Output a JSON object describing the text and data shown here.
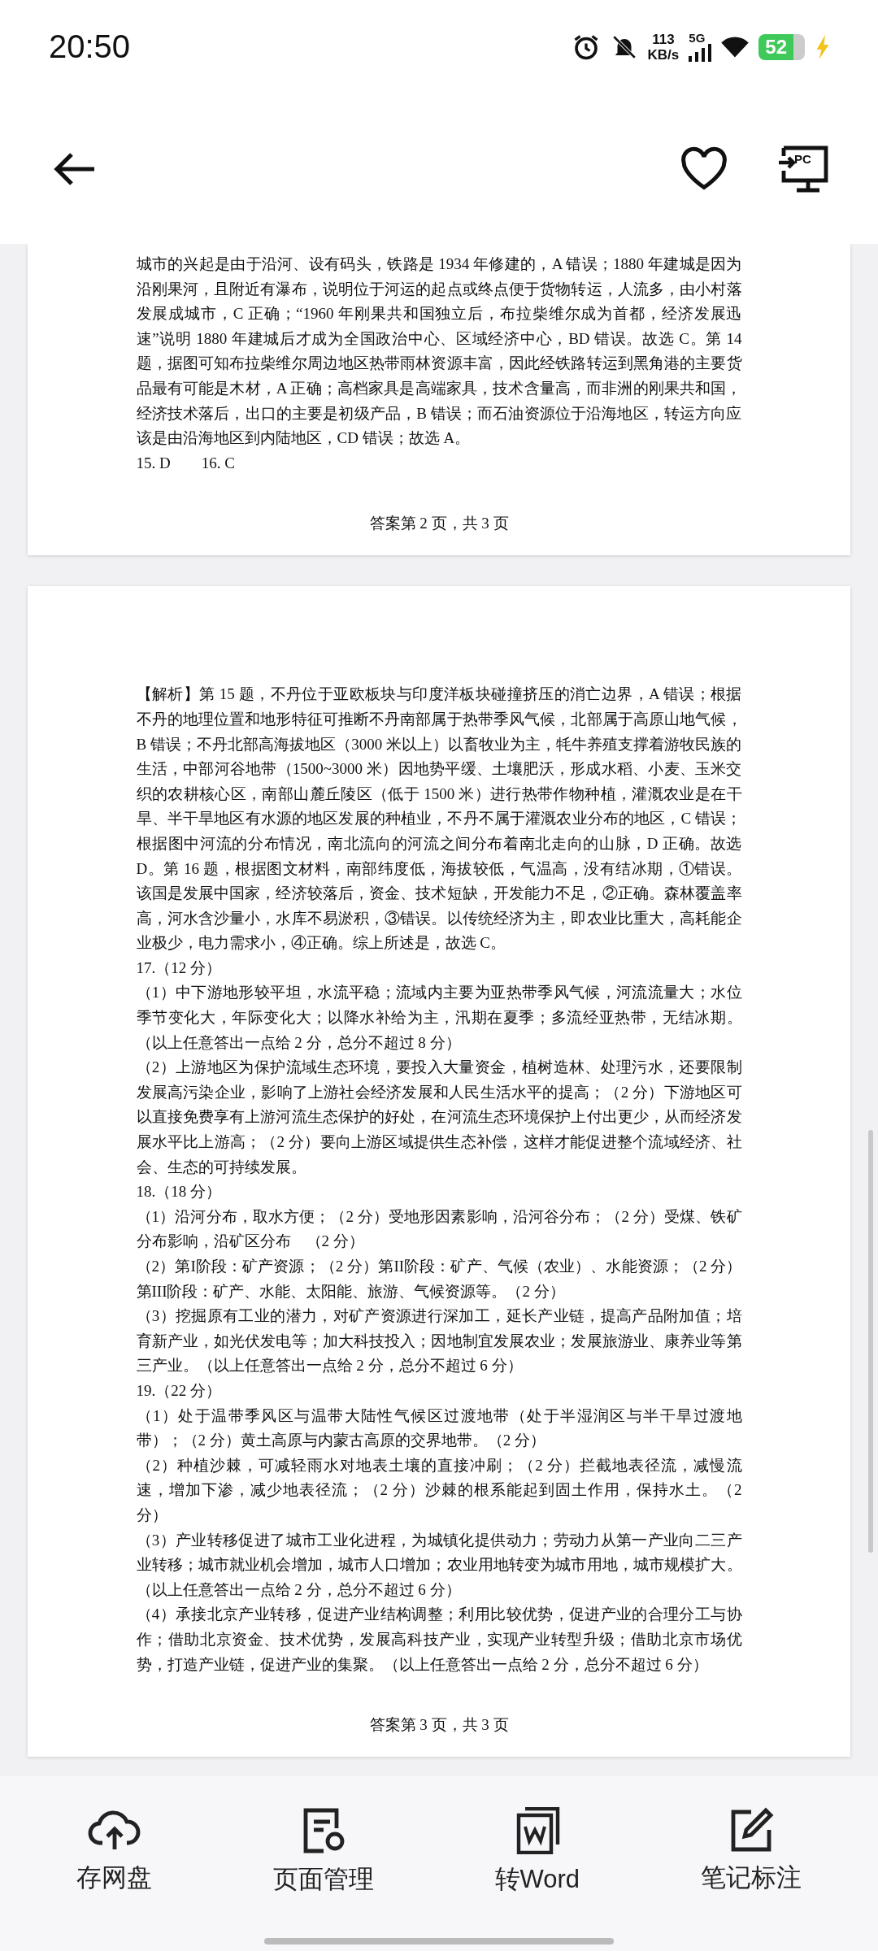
{
  "status_bar": {
    "time": "20:50",
    "speed_value": "113",
    "speed_unit": "KB/s",
    "network": "5G",
    "battery": "52"
  },
  "header": {
    "pc_icon_label": "PC"
  },
  "pages": [
    {
      "paragraphs": [
        "城市的兴起是由于沿河、设有码头，铁路是 1934 年修建的，A 错误；1880 年建城是因为沿刚果河，且附近有瀑布，说明位于河运的起点或终点便于货物转运，人流多，由小村落发展成城市，C 正确；“1960 年刚果共和国独立后，布拉柴维尔成为首都，经济发展迅速”说明 1880 年建城后才成为全国政治中心、区域经济中心，BD 错误。故选 C。第 14 题，据图可知布拉柴维尔周边地区热带雨林资源丰富，因此经铁路转运到黑角港的主要货品最有可能是木材，A 正确；高档家具是高端家具，技术含量高，而非洲的刚果共和国，经济技术落后，出口的主要是初级产品，B 错误；而石油资源位于沿海地区，转运方向应该是由沿海地区到内陆地区，CD 错误；故选 A。",
        "15. D　　16. C"
      ],
      "footer": "答案第 2 页，共 3 页"
    },
    {
      "paragraphs": [
        "【解析】第 15 题，不丹位于亚欧板块与印度洋板块碰撞挤压的消亡边界，A 错误；根据不丹的地理位置和地形特征可推断不丹南部属于热带季风气候，北部属于高原山地气候，B 错误；不丹北部高海拔地区（3000 米以上）以畜牧业为主，牦牛养殖支撑着游牧民族的生活，中部河谷地带（1500~3000 米）因地势平缓、土壤肥沃，形成水稻、小麦、玉米交织的农耕核心区，南部山麓丘陵区（低于 1500 米）进行热带作物种植，灌溉农业是在干旱、半干旱地区有水源的地区发展的种植业，不丹不属于灌溉农业分布的地区，C 错误；根据图中河流的分布情况，南北流向的河流之间分布着南北走向的山脉，D 正确。故选 D。第 16 题，根据图文材料，南部纬度低，海拔较低，气温高，没有结冰期，①错误。该国是发展中国家，经济较落后，资金、技术短缺，开发能力不足，②正确。森林覆盖率高，河水含沙量小，水库不易淤积，③错误。以传统经济为主，即农业比重大，高耗能企业极少，电力需求小，④正确。综上所述是，故选 C。",
        "17.（12 分）",
        "（1）中下游地形较平坦，水流平稳；流域内主要为亚热带季风气候，河流流量大；水位季节变化大，年际变化大；以降水补给为主，汛期在夏季；多流经亚热带，无结冰期。（以上任意答出一点给 2 分，总分不超过 8 分）",
        "（2）上游地区为保护流域生态环境，要投入大量资金，植树造林、处理污水，还要限制发展高污染企业，影响了上游社会经济发展和人民生活水平的提高；（2 分）下游地区可以直接免费享有上游河流生态保护的好处，在河流生态环境保护上付出更少，从而经济发展水平比上游高；（2 分）要向上游区域提供生态补偿，这样才能促进整个流域经济、社会、生态的可持续发展。",
        "18.（18 分）",
        "（1）沿河分布，取水方便；（2 分）受地形因素影响，沿河谷分布；（2 分）受煤、铁矿分布影响，沿矿区分布　（2 分）",
        "（2）第I阶段：矿产资源；（2 分）第II阶段：矿产、气候（农业）、水能资源；（2 分）第III阶段：矿产、水能、太阳能、旅游、气候资源等。（2 分）",
        "（3）挖掘原有工业的潜力，对矿产资源进行深加工，延长产业链，提高产品附加值；培育新产业，如光伏发电等；加大科技投入；因地制宜发展农业；发展旅游业、康养业等第三产业。（以上任意答出一点给 2 分，总分不超过 6 分）",
        "19.（22 分）",
        "（1）处于温带季风区与温带大陆性气候区过渡地带（处于半湿润区与半干旱过渡地带）；（2 分）黄土高原与内蒙古高原的交界地带。（2 分）",
        "（2）种植沙棘，可减轻雨水对地表土壤的直接冲刷；（2 分）拦截地表径流，减慢流速，增加下渗，减少地表径流；（2 分）沙棘的根系能起到固土作用，保持水土。（2 分）",
        "（3）产业转移促进了城市工业化进程，为城镇化提供动力；劳动力从第一产业向二三产业转移；城市就业机会增加，城市人口增加；农业用地转变为城市用地，城市规模扩大。（以上任意答出一点给 2 分，总分不超过 6 分）",
        "（4）承接北京产业转移，促进产业结构调整；利用比较优势，促进产业的合理分工与协作；借助北京资金、技术优势，发展高科技产业，实现产业转型升级；借助北京市场优势，打造产业链，促进产业的集聚。（以上任意答出一点给 2 分，总分不超过 6 分）"
      ],
      "footer": "答案第 3 页，共 3 页"
    }
  ],
  "toolbar": [
    {
      "kind": "cloud",
      "label": "存网盘"
    },
    {
      "kind": "pages",
      "label": "页面管理"
    },
    {
      "kind": "word",
      "label": "转Word"
    },
    {
      "kind": "note",
      "label": "笔记标注"
    }
  ]
}
